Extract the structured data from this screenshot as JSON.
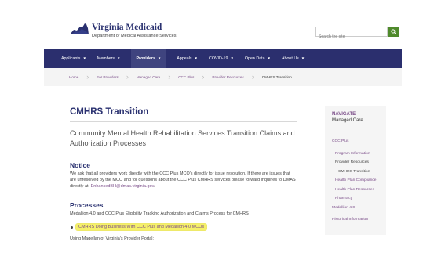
{
  "header": {
    "brand_title": "Virginia Medicaid",
    "brand_subtitle": "Department of Medical Assistance Services",
    "search_placeholder": "Search the site",
    "search_icon": "search-icon",
    "accent": "#4f8a2b"
  },
  "nav": {
    "color": "#2b2f6e",
    "items": [
      {
        "label": "Applicants"
      },
      {
        "label": "Members"
      },
      {
        "label": "Providers"
      },
      {
        "label": "Appeals"
      },
      {
        "label": "COVID-19"
      },
      {
        "label": "Open Data"
      },
      {
        "label": "About Us"
      }
    ]
  },
  "breadcrumb": [
    "Home",
    "For Providers",
    "Managed Care",
    "CCC Plus",
    "Provider Resources",
    "CMHRS Transition"
  ],
  "main": {
    "title": "CMHRS Transition",
    "subtitle": "Community Mental Health Rehabilitation Services Transition Claims and Authorization Processes",
    "notice_heading": "Notice",
    "notice_text": "We ask that all providers work directly with the CCC Plus MCO's directly for issue resolution. If there are issues that are unresolved by the MCO and for questions about the CCC Plus CMHRS services please forward inquiries to DMAS directly at: ",
    "notice_email": "EnhancedBH@dmas.virginia.gov",
    "notice_end": ".",
    "processes_heading": "Processes",
    "processes_text": "Medallion 4.0 and CCC Plus Eligibility Tracking Authorization and Claims Process for CMHRS",
    "bullet_link": "CMHRS Doing Business With CCC Plus and Medallion 4.0 MCOs",
    "portal_text": "Using Magellan of Virginia's Provider Portal:"
  },
  "sidebar": {
    "label": "NAVIGATE",
    "section": "Managed Care",
    "links": [
      {
        "label": "CCC Plus"
      },
      {
        "label": "Program Information"
      },
      {
        "label": "Provider Resources"
      },
      {
        "label": "CMHRS Transition"
      },
      {
        "label": "Health Plan Compliance"
      },
      {
        "label": "Health Plan Resources"
      },
      {
        "label": "Pharmacy"
      },
      {
        "label": "Medallion 4.0"
      },
      {
        "label": "Historical Information"
      }
    ]
  }
}
